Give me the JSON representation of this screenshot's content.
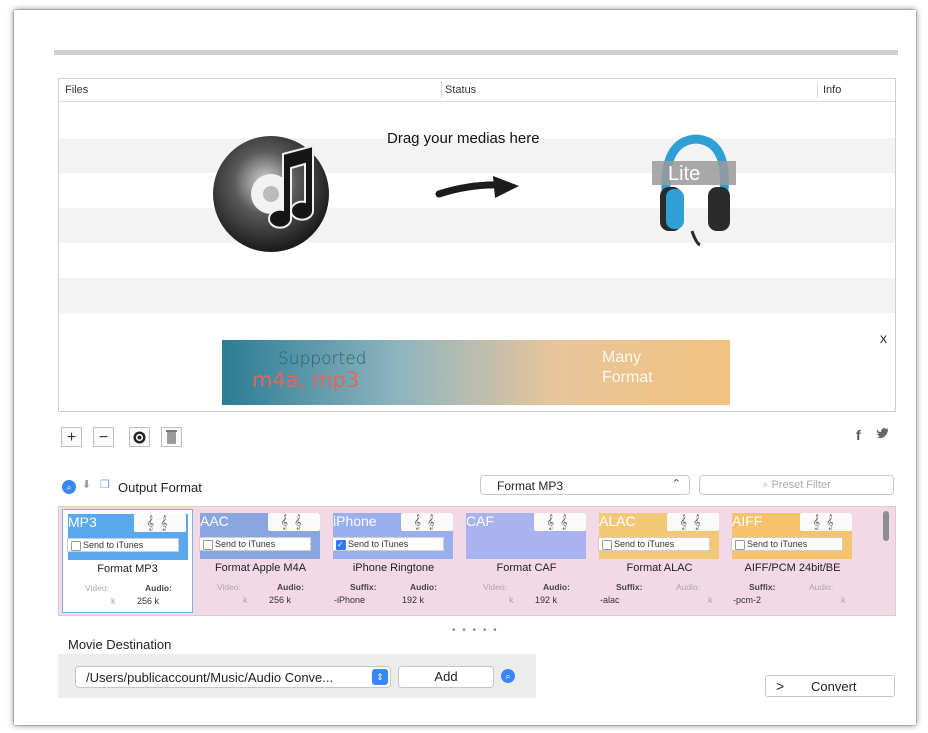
{
  "file_list": {
    "columns": [
      "Files",
      "Status",
      "Info"
    ],
    "drop_hint": "Drag your medias here",
    "remove_label": "x",
    "lite_badge": "Lite"
  },
  "banner": {
    "left_line1": "Supported",
    "left_line2": "m4a, mp3",
    "right_line1": "Many",
    "right_line2": "Format"
  },
  "toolbar": {
    "add_label": "+",
    "remove_label": "−",
    "facebook": "f",
    "twitter": "🐦"
  },
  "output": {
    "label": "Output Format",
    "selected_format": "Format MP3",
    "filter_placeholder": "Preset Filter"
  },
  "formats": [
    {
      "name": "MP3",
      "send": "Send to iTunes",
      "checked": false,
      "title": "Format MP3",
      "left_label": "Video:",
      "right_label": "Audio:",
      "left_value": "k",
      "right_value": "256  k",
      "color": "#5aa9ec",
      "selected": true
    },
    {
      "name": "AAC",
      "send": "Send to iTunes",
      "checked": false,
      "title": "Format Apple M4A",
      "left_label": "Video:",
      "right_label": "Audio:",
      "left_value": "k",
      "right_value": "256  k",
      "color": "#8aa6df",
      "selected": false
    },
    {
      "name": "iPhone",
      "send": "Send to iTunes",
      "checked": true,
      "title": "iPhone Ringtone",
      "left_label": "Suffix:",
      "right_label": "Audio:",
      "left_value": "-iPhone",
      "right_value": "192  k",
      "color": "#9aaff0",
      "selected": false
    },
    {
      "name": "CAF",
      "send": "",
      "checked": false,
      "title": "Format CAF",
      "left_label": "Video:",
      "right_label": "Audio:",
      "left_value": "k",
      "right_value": "192  k",
      "color": "#a8b3f0",
      "selected": false
    },
    {
      "name": "ALAC",
      "send": "Send to iTunes",
      "checked": false,
      "title": "Format ALAC",
      "left_label": "Suffix:",
      "right_label": "Audio:",
      "left_value": "-alac",
      "right_value": "k",
      "color": "#f4c877",
      "selected": false
    },
    {
      "name": "AIFF",
      "send": "Send to iTunes",
      "checked": false,
      "title": "AIFF/PCM 24bit/BE",
      "left_label": "Suffix:",
      "right_label": "Audio:",
      "left_value": "-pcm-2",
      "right_value": "k",
      "color": "#f6c26e",
      "selected": false
    }
  ],
  "pager_dots": "• • • • •",
  "destination": {
    "label": "Movie Destination",
    "path": "/Users/publicaccount/Music/Audio Conve...",
    "add_label": "Add"
  },
  "convert": {
    "chevron": ">",
    "label": "Convert"
  }
}
